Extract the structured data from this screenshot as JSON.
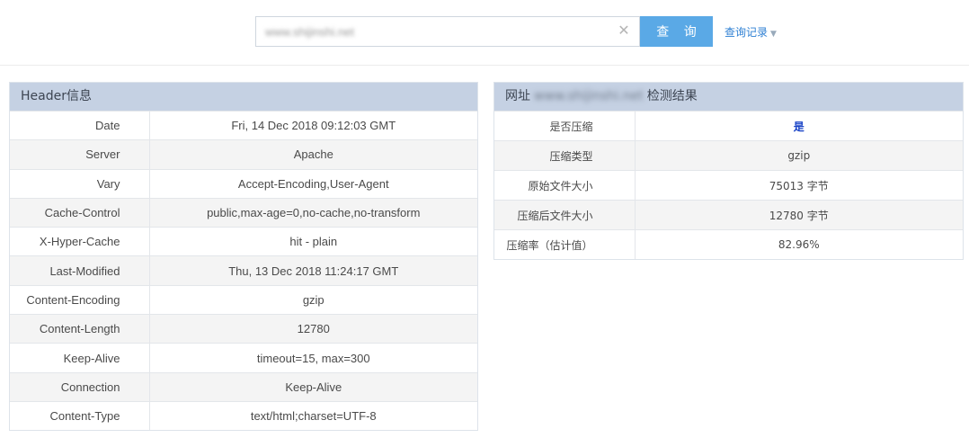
{
  "search": {
    "value": "www.shijinshi.net",
    "clear_icon": "close-icon",
    "button_label": "查 询",
    "history_label": "查询记录",
    "history_icon": "caret-down-icon"
  },
  "colors": {
    "button": "#5aa9e6",
    "panel_header": "#c5d1e3",
    "link": "#2d7fd3",
    "yes": "#1a44c7"
  },
  "header_panel": {
    "title": "Header信息",
    "rows": [
      {
        "key": "Date",
        "value": "Fri, 14 Dec 2018 09:12:03 GMT"
      },
      {
        "key": "Server",
        "value": "Apache"
      },
      {
        "key": "Vary",
        "value": "Accept-Encoding,User-Agent"
      },
      {
        "key": "Cache-Control",
        "value": "public,max-age=0,no-cache,no-transform"
      },
      {
        "key": "X-Hyper-Cache",
        "value": "hit - plain"
      },
      {
        "key": "Last-Modified",
        "value": "Thu, 13 Dec 2018 11:24:17 GMT"
      },
      {
        "key": "Content-Encoding",
        "value": "gzip"
      },
      {
        "key": "Content-Length",
        "value": "12780"
      },
      {
        "key": "Keep-Alive",
        "value": "timeout=15, max=300"
      },
      {
        "key": "Connection",
        "value": "Keep-Alive"
      },
      {
        "key": "Content-Type",
        "value": "text/html;charset=UTF-8"
      }
    ]
  },
  "result_panel": {
    "title_prefix": "网址",
    "title_url": "www.shijinshi.net",
    "title_suffix": "检测结果",
    "rows": [
      {
        "key": "是否压缩",
        "value": "是"
      },
      {
        "key": "压缩类型",
        "value": "gzip"
      },
      {
        "key": "原始文件大小",
        "value": "75013 字节"
      },
      {
        "key": "压缩后文件大小",
        "value": "12780 字节"
      },
      {
        "key": "压缩率（估计值）",
        "value": "82.96%"
      }
    ]
  }
}
